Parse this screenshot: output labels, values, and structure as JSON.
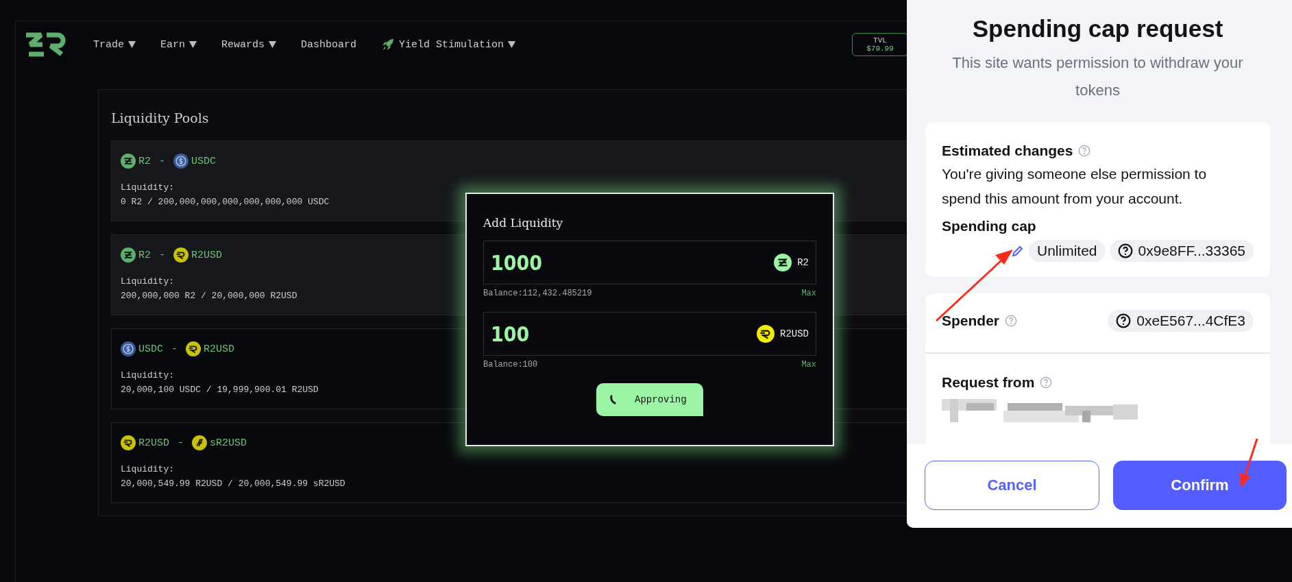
{
  "nav": {
    "items": [
      {
        "label": "Trade",
        "dropdown": true,
        "kind": "plain"
      },
      {
        "label": "Earn",
        "dropdown": true,
        "kind": "plain"
      },
      {
        "label": "Rewards",
        "dropdown": true,
        "kind": "plain"
      },
      {
        "label": "Dashboard",
        "dropdown": false,
        "kind": "plain"
      },
      {
        "label": "Yield Stimulation",
        "dropdown": true,
        "kind": "promo"
      }
    ],
    "tvl": {
      "label": "TVL",
      "value": "$79.99"
    }
  },
  "pools": {
    "title": "Liquidity Pools",
    "items": [
      {
        "highlighted": true,
        "token_a": {
          "symbol": "R2",
          "kind": "r2"
        },
        "separator": "-",
        "token_b": {
          "symbol": "USDC",
          "kind": "usdc"
        },
        "liquidity_label": "Liquidity:",
        "liquidity": "0 R2 / 200,000,000,000,000,000,000 USDC"
      },
      {
        "highlighted": true,
        "token_a": {
          "symbol": "R2",
          "kind": "r2"
        },
        "separator": "-",
        "token_b": {
          "symbol": "R2USD",
          "kind": "r2usd"
        },
        "liquidity_label": "Liquidity:",
        "liquidity": "200,000,000 R2 / 20,000,000 R2USD"
      },
      {
        "highlighted": false,
        "token_a": {
          "symbol": "USDC",
          "kind": "usdc"
        },
        "separator": "-",
        "token_b": {
          "symbol": "R2USD",
          "kind": "r2usd"
        },
        "liquidity_label": "Liquidity:",
        "liquidity": "20,000,100 USDC / 19,999,900.01 R2USD"
      },
      {
        "highlighted": false,
        "token_a": {
          "symbol": "R2USD",
          "kind": "r2usd"
        },
        "separator": "-",
        "token_b": {
          "symbol": "sR2USD",
          "kind": "sr2usd"
        },
        "liquidity_label": "Liquidity:",
        "liquidity": "20,000,549.99 R2USD / 20,000,549.99 sR2USD"
      }
    ]
  },
  "add_liquidity": {
    "title": "Add Liquidity",
    "inputs": [
      {
        "value": "1000",
        "token": {
          "symbol": "R2",
          "kind": "r2"
        },
        "balance": "Balance:112,432.485219",
        "max": "Max"
      },
      {
        "value": "100",
        "token": {
          "symbol": "R2USD",
          "kind": "r2usd"
        },
        "balance": "Balance:100",
        "max": "Max"
      }
    ],
    "button": {
      "label": "Approving",
      "loading": true
    }
  },
  "spending_cap": {
    "title": "Spending cap request",
    "subtitle": "This site wants permission to withdraw your tokens",
    "estimated": {
      "title": "Estimated changes",
      "description": "You're giving someone else permission to spend this amount from your account.",
      "cap_label": "Spending cap",
      "cap_value": "Unlimited",
      "cap_address": "0x9e8FF...33365"
    },
    "spender": {
      "label": "Spender",
      "address": "0xeE567...4CfE3"
    },
    "request_from": {
      "label": "Request from"
    },
    "buttons": [
      {
        "label": "Cancel",
        "kind": "secondary"
      },
      {
        "label": "Confirm",
        "kind": "primary"
      }
    ]
  }
}
